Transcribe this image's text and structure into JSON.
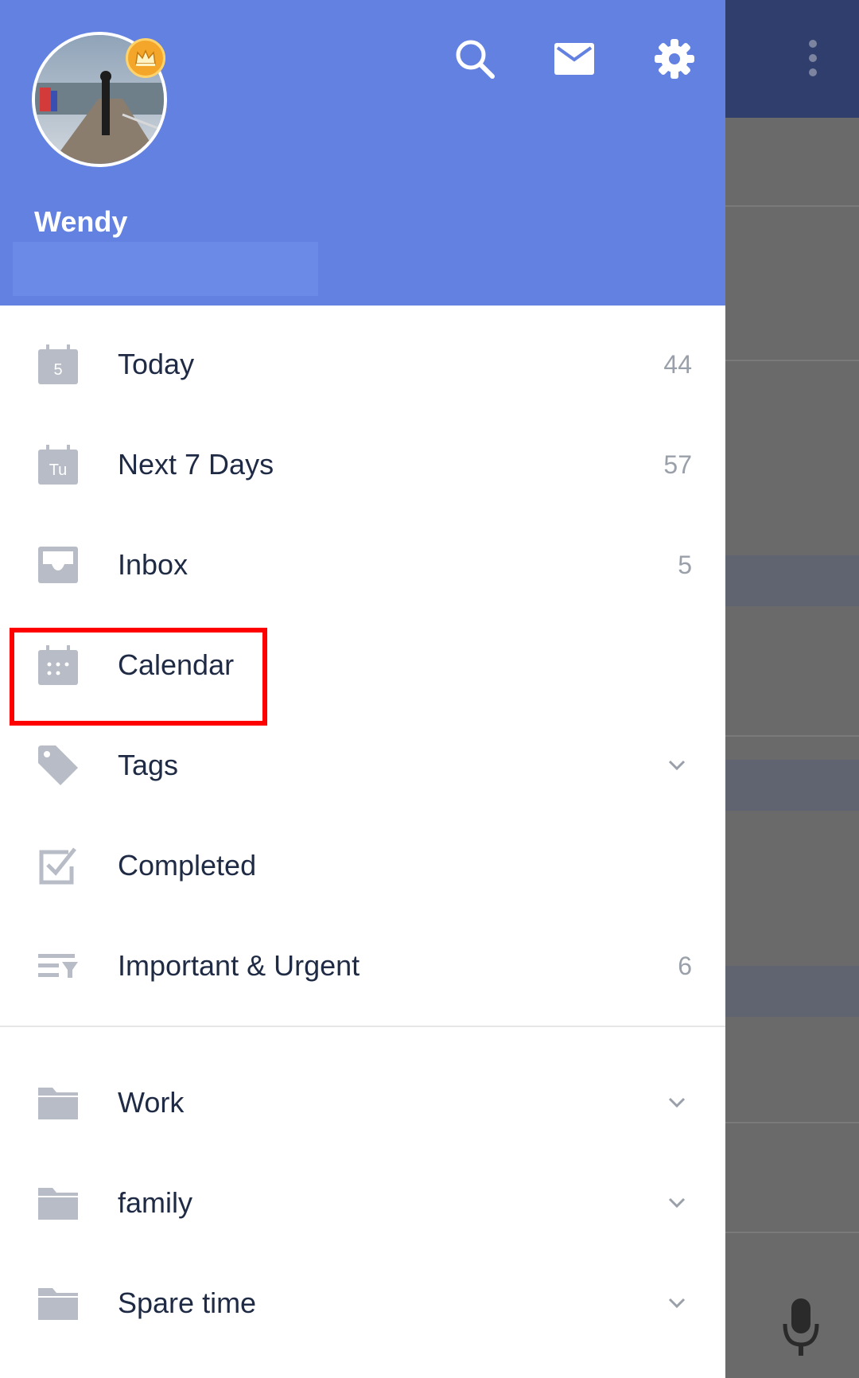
{
  "header": {
    "user_name": "Wendy",
    "user_email": ""
  },
  "menu": {
    "items": [
      {
        "label": "Today",
        "count": "44",
        "icon": "calendar-today-icon",
        "icon_text": "5"
      },
      {
        "label": "Next 7 Days",
        "count": "57",
        "icon": "calendar-week-icon",
        "icon_text": "Tu"
      },
      {
        "label": "Inbox",
        "count": "5",
        "icon": "inbox-icon"
      },
      {
        "label": "Calendar",
        "count": "",
        "icon": "calendar-icon"
      },
      {
        "label": "Tags",
        "count": "",
        "icon": "tag-icon"
      },
      {
        "label": "Completed",
        "count": "",
        "icon": "checkbox-icon"
      },
      {
        "label": "Important & Urgent",
        "count": "6",
        "icon": "filter-icon"
      }
    ],
    "lists": [
      {
        "label": "Work",
        "icon": "folder-icon"
      },
      {
        "label": "family",
        "icon": "folder-icon"
      },
      {
        "label": "Spare time",
        "icon": "folder-icon"
      }
    ]
  },
  "colors": {
    "header_bg": "#6381e0",
    "icon_gray": "#b7bcc6",
    "text_dark": "#1f2a44",
    "highlight": "#ff0000"
  }
}
